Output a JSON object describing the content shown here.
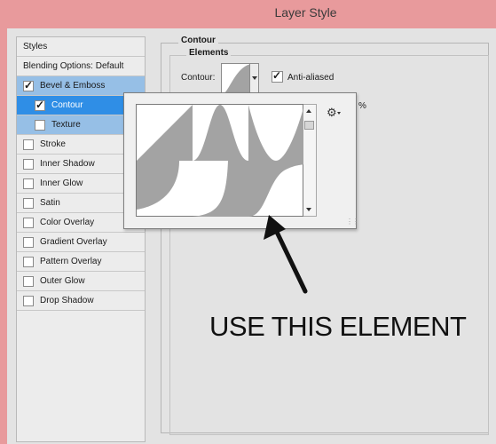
{
  "window": {
    "title": "Layer Style"
  },
  "sidebar": {
    "header": "Styles",
    "blending": "Blending Options: Default",
    "items": [
      {
        "label": "Bevel & Emboss",
        "checked": true
      },
      {
        "label": "Contour",
        "checked": true
      },
      {
        "label": "Texture",
        "checked": false
      },
      {
        "label": "Stroke",
        "checked": false
      },
      {
        "label": "Inner Shadow",
        "checked": false
      },
      {
        "label": "Inner Glow",
        "checked": false
      },
      {
        "label": "Satin",
        "checked": false
      },
      {
        "label": "Color Overlay",
        "checked": false
      },
      {
        "label": "Gradient Overlay",
        "checked": false
      },
      {
        "label": "Pattern Overlay",
        "checked": false
      },
      {
        "label": "Outer Glow",
        "checked": false
      },
      {
        "label": "Drop Shadow",
        "checked": false
      }
    ]
  },
  "panel": {
    "group_title": "Contour",
    "subgroup_title": "Elements",
    "contour_label": "Contour:",
    "antialiased_label": "Anti-aliased",
    "antialiased_checked": true,
    "percent_sign": "%"
  },
  "picker": {
    "presets": [
      "linear",
      "gaussian",
      "cone-inverted",
      "half-round",
      "rounded-steps",
      "ring"
    ],
    "menu_icon": "gear-icon"
  },
  "annotation": {
    "text": "USE THIS ELEMENT"
  },
  "colors": {
    "window_border": "#e89a9c",
    "selected": "#2f8ee6",
    "highlight": "#96bfe6",
    "contour_fill": "#a3a3a3"
  }
}
